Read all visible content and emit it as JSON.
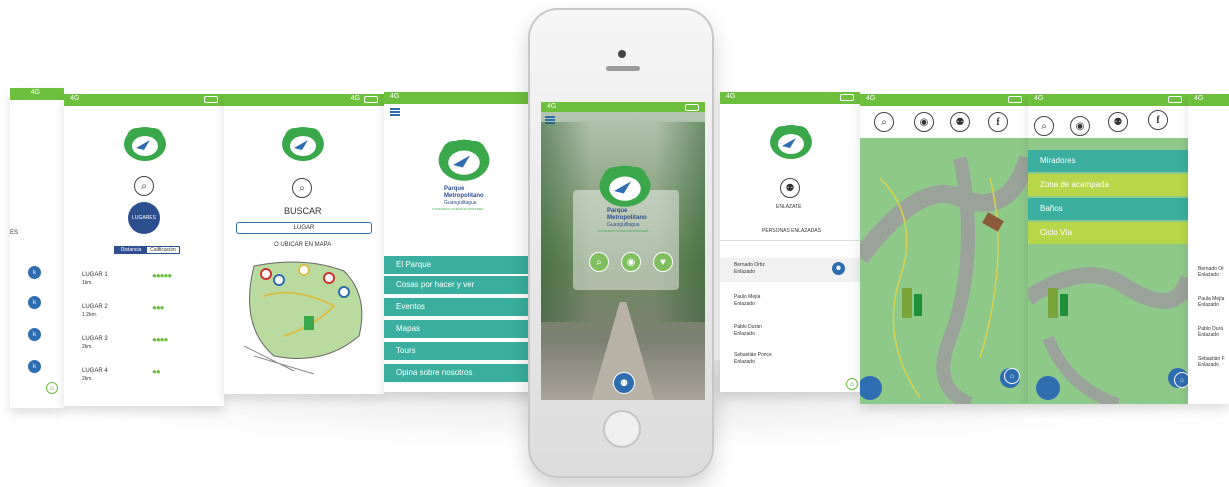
{
  "status": {
    "network": "4G"
  },
  "screen_places": {
    "header_label": "ES",
    "places": [
      {
        "name": "LUGAR 1",
        "distance": "1km.",
        "rating": "●●●●●"
      },
      {
        "name": "LUGAR 2",
        "distance": "1.2km.",
        "rating": "●●●"
      },
      {
        "name": "LUGAR 3",
        "distance": "2km.",
        "rating": "●●●●"
      },
      {
        "name": "LUGAR 4",
        "distance": "2km.",
        "rating": "●●"
      }
    ],
    "lugares_badge": "LUGARES",
    "sort_distance": "Distancia",
    "sort_rating": "Calificación"
  },
  "screen_search": {
    "title": "BUSCAR",
    "input_value": "LUGAR",
    "map_label": "O UBICAR EN MAPA"
  },
  "screen_menu": {
    "park_name_line1": "Parque",
    "park_name_line2": "Metropolitano",
    "park_city": "Guangüiltagua",
    "park_tag": "CONSORCIO CIUDAD ECOSISTEMA",
    "items": [
      "El Parque",
      "Cosas por hacer y ver",
      "Eventos",
      "Mapas",
      "Tours",
      "Opina sobre nosotros"
    ]
  },
  "screen_social": {
    "enlazate": "ENLÁZATE",
    "section_title": "PERSONAS ENLAZADAS",
    "people": [
      {
        "name": "Bernado Ortiz",
        "status": "Enlazado"
      },
      {
        "name": "Paulo Mejía",
        "status": "Enlazado"
      },
      {
        "name": "Pablo Durán",
        "status": "Enlazado"
      },
      {
        "name": "Sebastián Ponce",
        "status": "Enlazado"
      }
    ]
  },
  "screen_map_categories": {
    "items": [
      "Miradores",
      "Zona de acampada",
      "Baños",
      "Ciclo Vía"
    ]
  },
  "screen_right_list": {
    "people": [
      {
        "name": "Bernado Or",
        "status": "Enlazado"
      },
      {
        "name": "Paula Mejía",
        "status": "Enlazado"
      },
      {
        "name": "Pablo Durá",
        "status": "Enlazado"
      },
      {
        "name": "Sebastián F",
        "status": "Enlazado"
      }
    ]
  },
  "icons": [
    "search-icon",
    "location-icon",
    "people-icon",
    "facebook-icon",
    "home-icon",
    "menu-icon",
    "heart-icon"
  ],
  "colors": {
    "brand_green": "#6dbf3e",
    "teal": "#3aaf9f",
    "lime": "#b7d64a",
    "blue": "#2e6db0"
  }
}
